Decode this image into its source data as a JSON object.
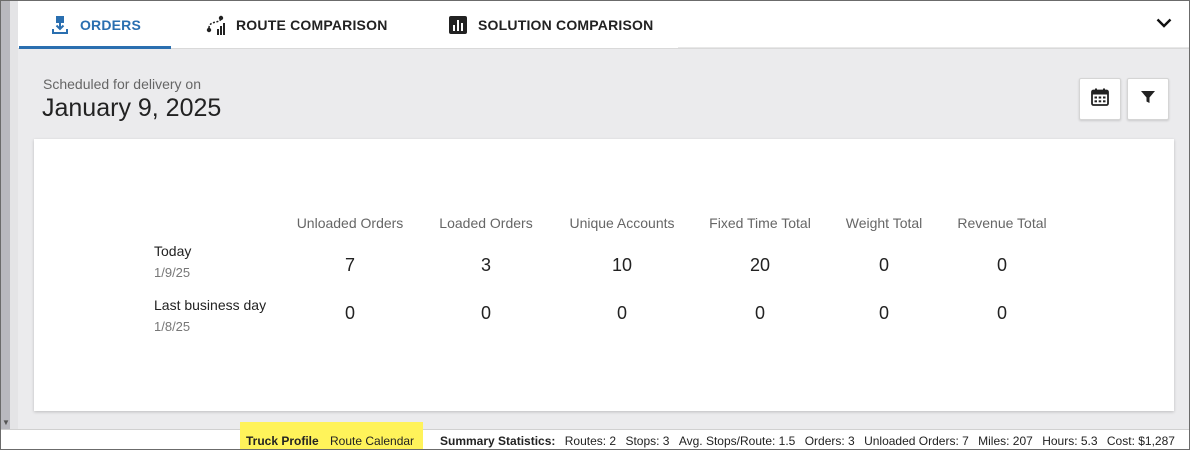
{
  "tabs": [
    {
      "label": "ORDERS",
      "icon": "orders-download-icon",
      "active": true
    },
    {
      "label": "ROUTE COMPARISON",
      "icon": "route-comparison-icon",
      "active": false
    },
    {
      "label": "SOLUTION COMPARISON",
      "icon": "bar-chart-icon",
      "active": false
    }
  ],
  "header": {
    "subtitle": "Scheduled for delivery on",
    "date": "January 9, 2025"
  },
  "toolbar": {
    "calendar_icon": "calendar-icon",
    "filter_icon": "filter-icon"
  },
  "summary_table": {
    "columns": [
      "Unloaded Orders",
      "Loaded Orders",
      "Unique Accounts",
      "Fixed Time Total",
      "Weight Total",
      "Revenue Total"
    ],
    "rows": [
      {
        "label": "Today",
        "date": "1/9/25",
        "values": [
          "7",
          "3",
          "10",
          "20",
          "0",
          "0"
        ]
      },
      {
        "label": "Last business day",
        "date": "1/8/25",
        "values": [
          "0",
          "0",
          "0",
          "0",
          "0",
          "0"
        ]
      }
    ]
  },
  "statusbar": {
    "truck_profile": "Truck Profile",
    "route_calendar": "Route Calendar",
    "summary_label": "Summary Statistics:",
    "stats": [
      "Routes: 2",
      "Stops: 3",
      "Avg. Stops/Route: 1.5",
      "Orders: 3",
      "Unloaded Orders: 7",
      "Miles: 207",
      "Hours: 5.3",
      "Cost: $1,287"
    ],
    "highlight_color": "#fff35a"
  },
  "colors": {
    "accent": "#2a6fb0",
    "background": "#ebebed"
  }
}
